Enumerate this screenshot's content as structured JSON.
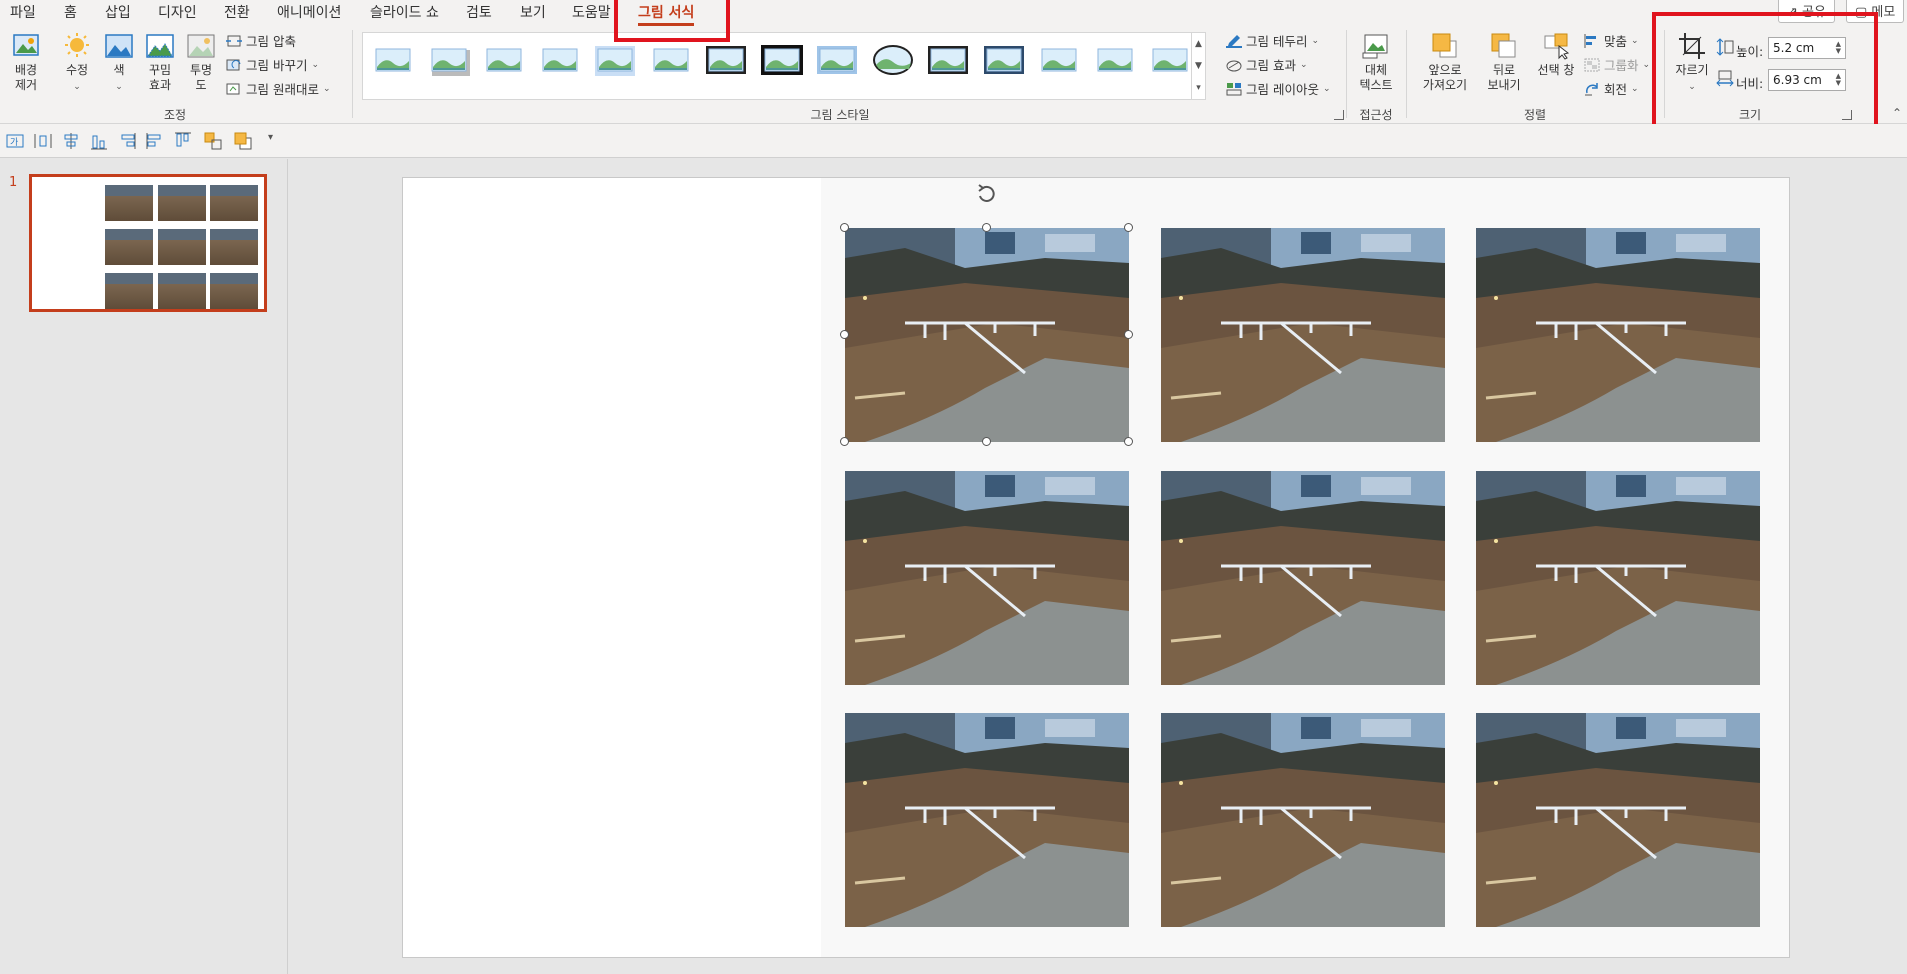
{
  "tabs": [
    {
      "label": "파일",
      "active": false
    },
    {
      "label": "홈",
      "active": false
    },
    {
      "label": "삽입",
      "active": false
    },
    {
      "label": "디자인",
      "active": false
    },
    {
      "label": "전환",
      "active": false
    },
    {
      "label": "애니메이션",
      "active": false
    },
    {
      "label": "슬라이드 쇼",
      "active": false
    },
    {
      "label": "검토",
      "active": false
    },
    {
      "label": "보기",
      "active": false
    },
    {
      "label": "도움말",
      "active": false
    },
    {
      "label": "그림 서식",
      "active": true
    }
  ],
  "top_right": {
    "share": "공유",
    "comments": "메모"
  },
  "ribbon": {
    "adjust": {
      "remove_bg": "배경\n제거",
      "corrections": "수정",
      "color": "색",
      "artistic": "꾸밈\n효과",
      "transparency": "투명\n도",
      "compress": "그림 압축",
      "change": "그림 바꾸기",
      "reset": "그림 원래대로",
      "group_label": "조정"
    },
    "styles": {
      "group_label": "그림 스타일",
      "border": "그림 테두리",
      "effects": "그림 효과",
      "layout": "그림 레이아웃"
    },
    "accessibility": {
      "alt_text": "대체\n텍스트",
      "group_label": "접근성"
    },
    "arrange": {
      "bring_forward": "앞으로\n가져오기",
      "send_backward": "뒤로\n보내기",
      "selection_pane": "선택 창",
      "align": "맞춤",
      "group": "그룹화",
      "rotate": "회전",
      "group_label": "정렬"
    },
    "size": {
      "crop": "자르기",
      "height_label": "높이:",
      "height_value": "5.2 cm",
      "width_label": "너비:",
      "width_value": "6.93 cm",
      "group_label": "크기"
    }
  },
  "thumbnails": {
    "slide_number": "1"
  },
  "colors": {
    "accent": "#c43e1c",
    "highlight": "#e0141e"
  }
}
